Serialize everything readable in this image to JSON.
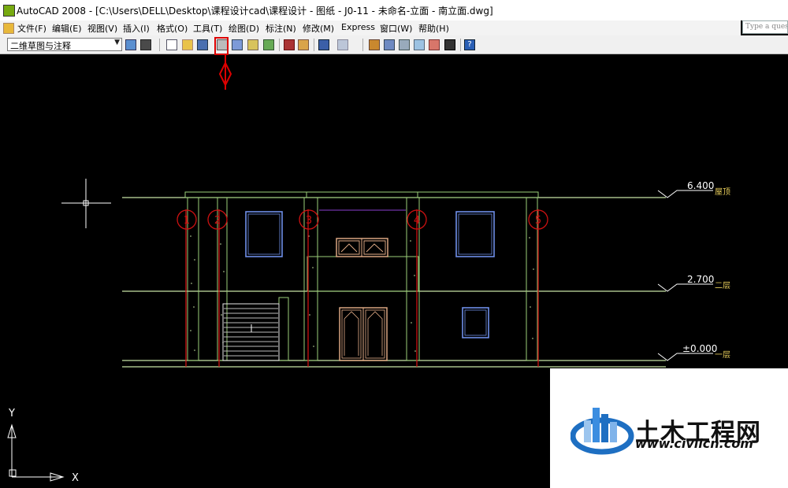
{
  "window": {
    "title": "AutoCAD 2008 - [C:\\Users\\DELL\\Desktop\\课程设计cad\\课程设计 - 图纸 - J0-11 - 未命名-立面 - 南立面.dwg]"
  },
  "help_search": {
    "placeholder": "Type a question"
  },
  "menu": [
    "文件(F)",
    "编辑(E)",
    "视图(V)",
    "插入(I)",
    "格式(O)",
    "工具(T)",
    "绘图(D)",
    "标注(N)",
    "修改(M)",
    "Express",
    "窗口(W)",
    "帮助(H)"
  ],
  "toolbar": {
    "workspace": "二维草图与注释"
  },
  "drawing": {
    "levels": [
      {
        "value": "6.400",
        "label": "屋顶"
      },
      {
        "value": "2.700",
        "label": "二层"
      },
      {
        "value": "±0.000",
        "label": "一层"
      }
    ],
    "axis_labels": [
      "1",
      "2",
      "3",
      "4",
      "5"
    ],
    "ucs": {
      "x": "X",
      "y": "Y"
    }
  },
  "watermark": {
    "name": "土木工程网",
    "url": "www.civilcn.com"
  },
  "colors": {
    "cad_background": "#000000",
    "line_green": "#9ccf7a",
    "axis_red": "#cc1111",
    "window_blue": "#6f8fe8",
    "door_tan": "#e8b08a",
    "highlight": "#dd0000",
    "logo_blue": "#1e6fc2"
  }
}
